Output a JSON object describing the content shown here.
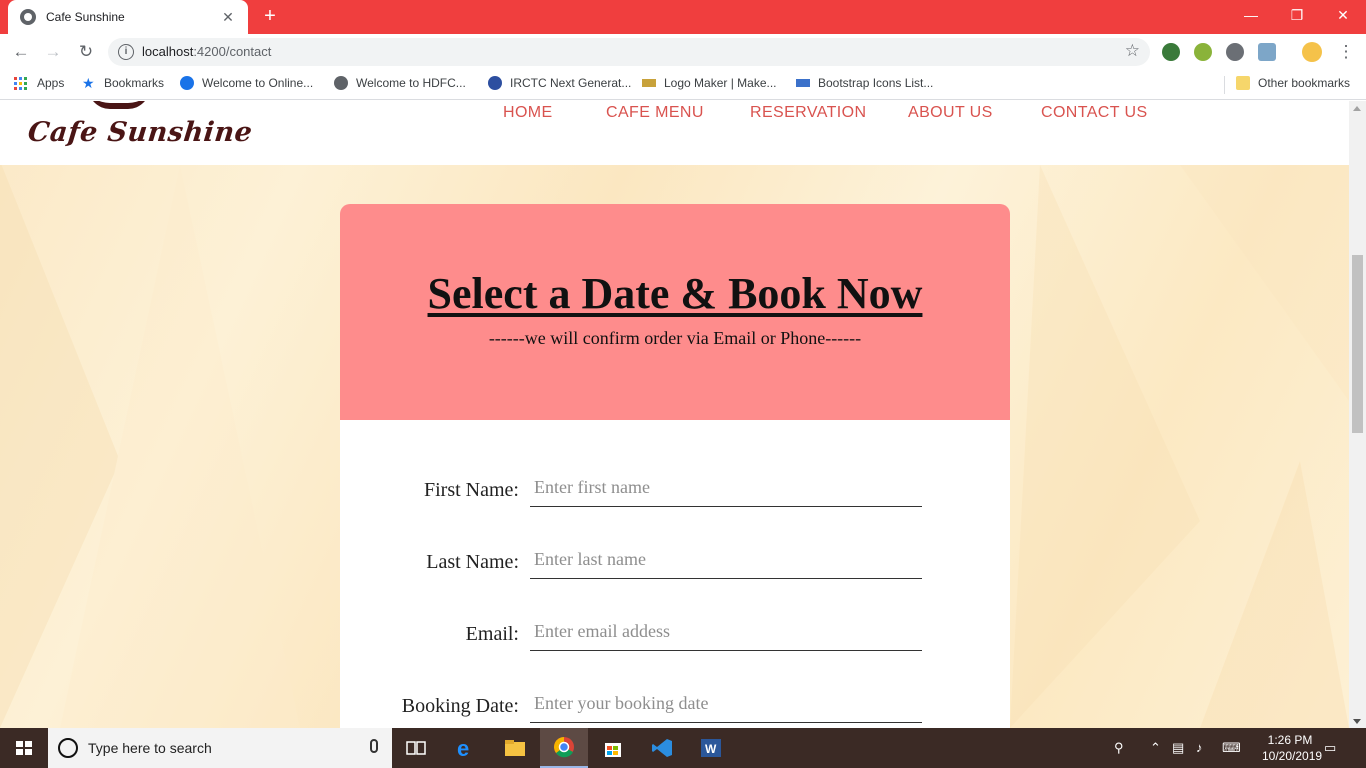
{
  "browser": {
    "tab_title": "Cafe Sunshine",
    "tab_close": "✕",
    "new_tab": "+",
    "url_host": "localhost",
    "url_path": ":4200/contact",
    "window_minimize": "—",
    "window_restore": "❐",
    "window_close": "✕"
  },
  "bookmarks": {
    "apps": "Apps",
    "items": [
      {
        "label": "Bookmarks",
        "icon": "star-icon"
      },
      {
        "label": "Welcome to Online...",
        "icon": "info-circle-icon"
      },
      {
        "label": "Welcome to HDFC...",
        "icon": "globe-icon"
      },
      {
        "label": "IRCTC Next Generat...",
        "icon": "irctc-icon"
      },
      {
        "label": "Logo Maker | Make...",
        "icon": "logo-maker-icon"
      },
      {
        "label": "Bootstrap Icons List...",
        "icon": "mdb-icon"
      }
    ],
    "other": "Other bookmarks"
  },
  "site": {
    "logo_text": "Cafe Sunshine",
    "nav": [
      "HOME",
      "CAFE MENU",
      "RESERVATION",
      "ABOUT US",
      "CONTACT US"
    ]
  },
  "booking": {
    "title": "Select a Date & Book Now",
    "subtitle": "------we will confirm order via Email or Phone------",
    "fields": [
      {
        "label": "First Name:",
        "placeholder": "Enter first name"
      },
      {
        "label": "Last Name:",
        "placeholder": "Enter last name"
      },
      {
        "label": "Email:",
        "placeholder": "Enter email addess"
      },
      {
        "label": "Booking Date:",
        "placeholder": "Enter your booking date"
      }
    ]
  },
  "taskbar": {
    "search_placeholder": "Type here to search",
    "time": "1:26 PM",
    "date": "10/20/2019"
  },
  "colors": {
    "chrome_frame": "#f03e3e",
    "nav_link": "#d9534f",
    "card_header": "#fe8c8c",
    "logo": "#4a1515",
    "taskbar": "#3b2a25"
  }
}
